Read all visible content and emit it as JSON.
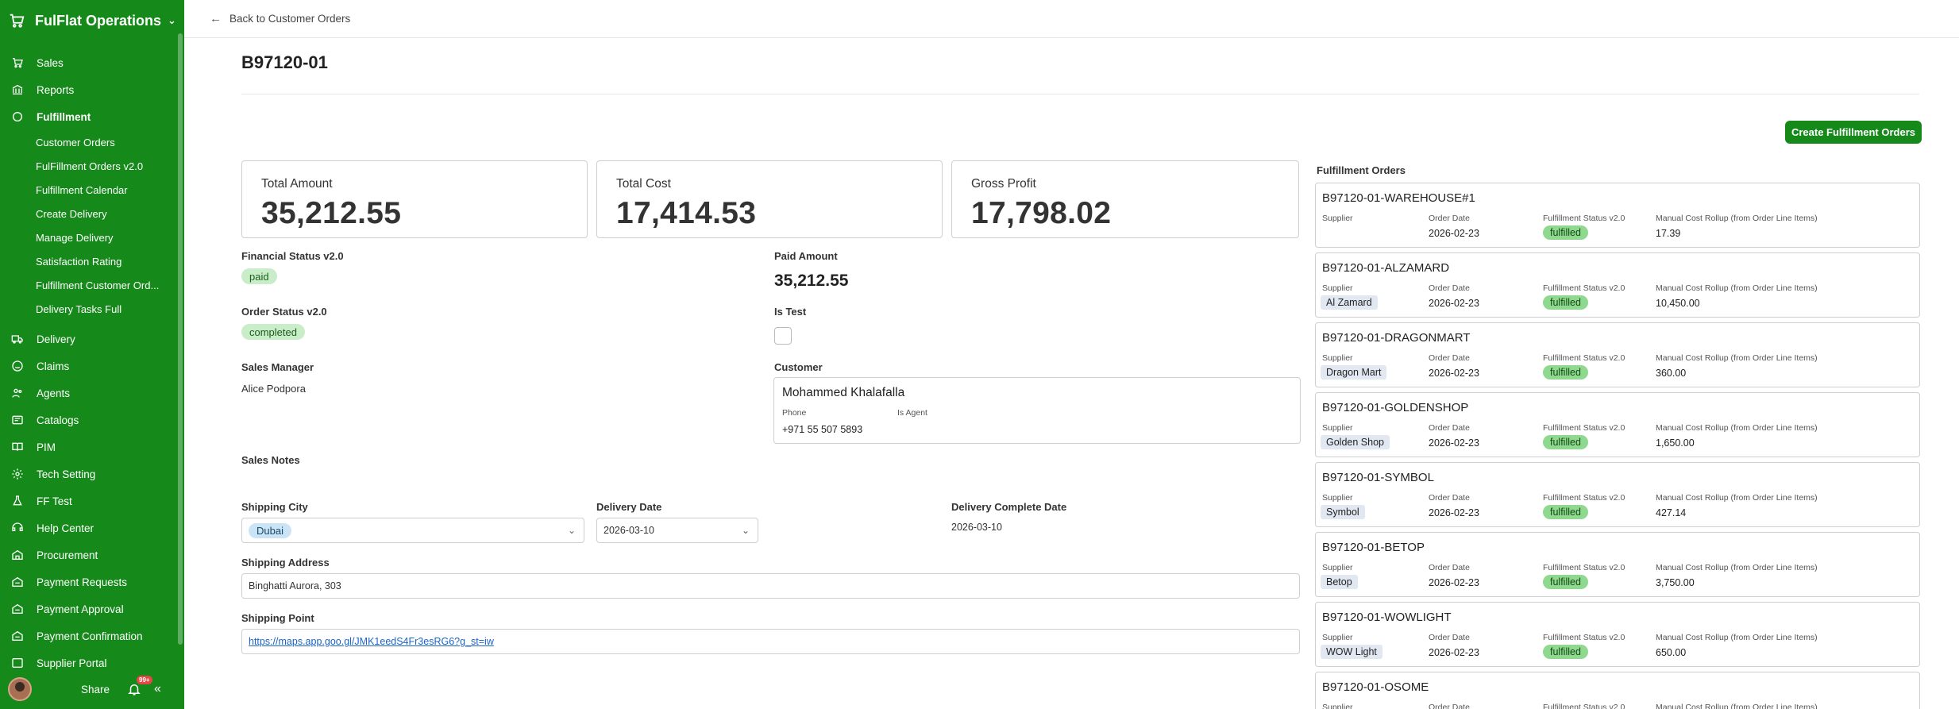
{
  "sidebar": {
    "workspace": "FulFlat Operations",
    "items": [
      {
        "label": "Sales",
        "icon": "cart-icon"
      },
      {
        "label": "Reports",
        "icon": "bank-icon"
      },
      {
        "label": "Fulfillment",
        "icon": "circle-icon"
      },
      {
        "label": "Delivery",
        "icon": "truck-icon"
      },
      {
        "label": "Claims",
        "icon": "smile-icon"
      },
      {
        "label": "Agents",
        "icon": "people-icon"
      },
      {
        "label": "Catalogs",
        "icon": "catalog-icon"
      },
      {
        "label": "PIM",
        "icon": "book-icon"
      },
      {
        "label": "Tech Setting",
        "icon": "gear-icon"
      },
      {
        "label": "FF Test",
        "icon": "flask-icon"
      },
      {
        "label": "Help Center",
        "icon": "help-icon"
      },
      {
        "label": "Procurement",
        "icon": "procurement-icon"
      },
      {
        "label": "Payment Requests",
        "icon": "payment-icon"
      },
      {
        "label": "Payment Approval",
        "icon": "payment-icon"
      },
      {
        "label": "Payment Confirmation",
        "icon": "payment-icon"
      },
      {
        "label": "Supplier Portal",
        "icon": "portal-icon"
      }
    ],
    "sub_items": [
      "Customer Orders",
      "FulFillment Orders v2.0",
      "Fulfillment Calendar",
      "Create Delivery",
      "Manage Delivery",
      "Satisfaction Rating",
      "Fulfillment Customer Ord...",
      "Delivery Tasks Full"
    ],
    "share_label": "Share",
    "notif_badge": "99+"
  },
  "header": {
    "back_label": "Back to Customer Orders"
  },
  "order": {
    "title": "B97120-01",
    "create_button": "Create Fulfillment Orders",
    "kpis": [
      {
        "label": "Total Amount",
        "value": "35,212.55"
      },
      {
        "label": "Total Cost",
        "value": "17,414.53"
      },
      {
        "label": "Gross Profit",
        "value": "17,798.02"
      }
    ],
    "financial_status_label": "Financial Status v2.0",
    "financial_status": "paid",
    "paid_amount_label": "Paid Amount",
    "paid_amount": "35,212.55",
    "order_status_label": "Order Status v2.0",
    "order_status": "completed",
    "is_test_label": "Is Test",
    "sales_manager_label": "Sales Manager",
    "sales_manager": "Alice Podpora",
    "customer_label": "Customer",
    "customer": {
      "name": "Mohammed Khalafalla",
      "phone_label": "Phone",
      "phone": "+971 55 507 5893",
      "is_agent_label": "Is Agent"
    },
    "sales_notes_label": "Sales Notes",
    "shipping_city_label": "Shipping City",
    "shipping_city": "Dubai",
    "delivery_date_label": "Delivery Date",
    "delivery_date": "2026-03-10",
    "delivery_complete_label": "Delivery Complete Date",
    "delivery_complete": "2026-03-10",
    "shipping_address_label": "Shipping Address",
    "shipping_address": "Binghatti Aurora, 303",
    "shipping_point_label": "Shipping Point",
    "shipping_point": "https://maps.app.goo.gl/JMK1eedS4Fr3esRG6?g_st=iw"
  },
  "fulfillment": {
    "title": "Fulfillment Orders",
    "col_supplier": "Supplier",
    "col_order_date": "Order Date",
    "col_status": "Fulfillment Status v2.0",
    "col_cost": "Manual Cost Rollup (from Order Line Items)",
    "orders": [
      {
        "name": "B97120-01-WAREHOUSE#1",
        "supplier": "",
        "date": "2026-02-23",
        "status": "fulfilled",
        "cost": "17.39"
      },
      {
        "name": "B97120-01-ALZAMARD",
        "supplier": "Al Zamard",
        "date": "2026-02-23",
        "status": "fulfilled",
        "cost": "10,450.00"
      },
      {
        "name": "B97120-01-DRAGONMART",
        "supplier": "Dragon Mart",
        "date": "2026-02-23",
        "status": "fulfilled",
        "cost": "360.00"
      },
      {
        "name": "B97120-01-GOLDENSHOP",
        "supplier": "Golden Shop",
        "date": "2026-02-23",
        "status": "fulfilled",
        "cost": "1,650.00"
      },
      {
        "name": "B97120-01-SYMBOL",
        "supplier": "Symbol",
        "date": "2026-02-23",
        "status": "fulfilled",
        "cost": "427.14"
      },
      {
        "name": "B97120-01-BETOP",
        "supplier": "Betop",
        "date": "2026-02-23",
        "status": "fulfilled",
        "cost": "3,750.00"
      },
      {
        "name": "B97120-01-WOWLIGHT",
        "supplier": "WOW Light",
        "date": "2026-02-23",
        "status": "fulfilled",
        "cost": "650.00"
      },
      {
        "name": "B97120-01-OSOME",
        "supplier": "",
        "date": "",
        "status": "",
        "cost": ""
      }
    ]
  }
}
